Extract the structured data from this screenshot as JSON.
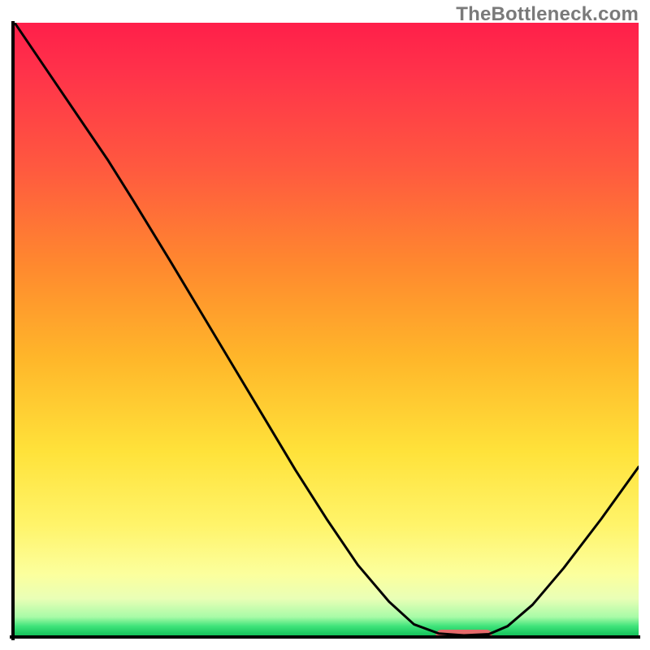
{
  "watermark": "TheBottleneck.com",
  "chart_data": {
    "type": "line",
    "title": "",
    "xlabel": "",
    "ylabel": "",
    "xlim": [
      0,
      100
    ],
    "ylim": [
      0,
      100
    ],
    "grid": false,
    "legend": false,
    "curve": [
      {
        "x": 0,
        "y": 100.0
      },
      {
        "x": 5,
        "y": 92.5
      },
      {
        "x": 10,
        "y": 85.0
      },
      {
        "x": 15,
        "y": 77.5
      },
      {
        "x": 19,
        "y": 71.0
      },
      {
        "x": 25,
        "y": 61.0
      },
      {
        "x": 30,
        "y": 52.5
      },
      {
        "x": 35,
        "y": 44.0
      },
      {
        "x": 40,
        "y": 35.5
      },
      {
        "x": 45,
        "y": 27.0
      },
      {
        "x": 50,
        "y": 19.0
      },
      {
        "x": 55,
        "y": 11.5
      },
      {
        "x": 60,
        "y": 5.5
      },
      {
        "x": 64,
        "y": 1.8
      },
      {
        "x": 68,
        "y": 0.3
      },
      {
        "x": 72,
        "y": 0.0
      },
      {
        "x": 76,
        "y": 0.2
      },
      {
        "x": 79,
        "y": 1.5
      },
      {
        "x": 83,
        "y": 5.0
      },
      {
        "x": 88,
        "y": 11.0
      },
      {
        "x": 94,
        "y": 19.0
      },
      {
        "x": 100,
        "y": 27.5
      }
    ],
    "marker": {
      "x_center": 72,
      "x_halfwidth": 4.5,
      "y": 0.0,
      "color": "#e46a6a"
    },
    "gradient_description": "vertical red→orange→yellow→pale→green (bottleneck severity scale)"
  }
}
